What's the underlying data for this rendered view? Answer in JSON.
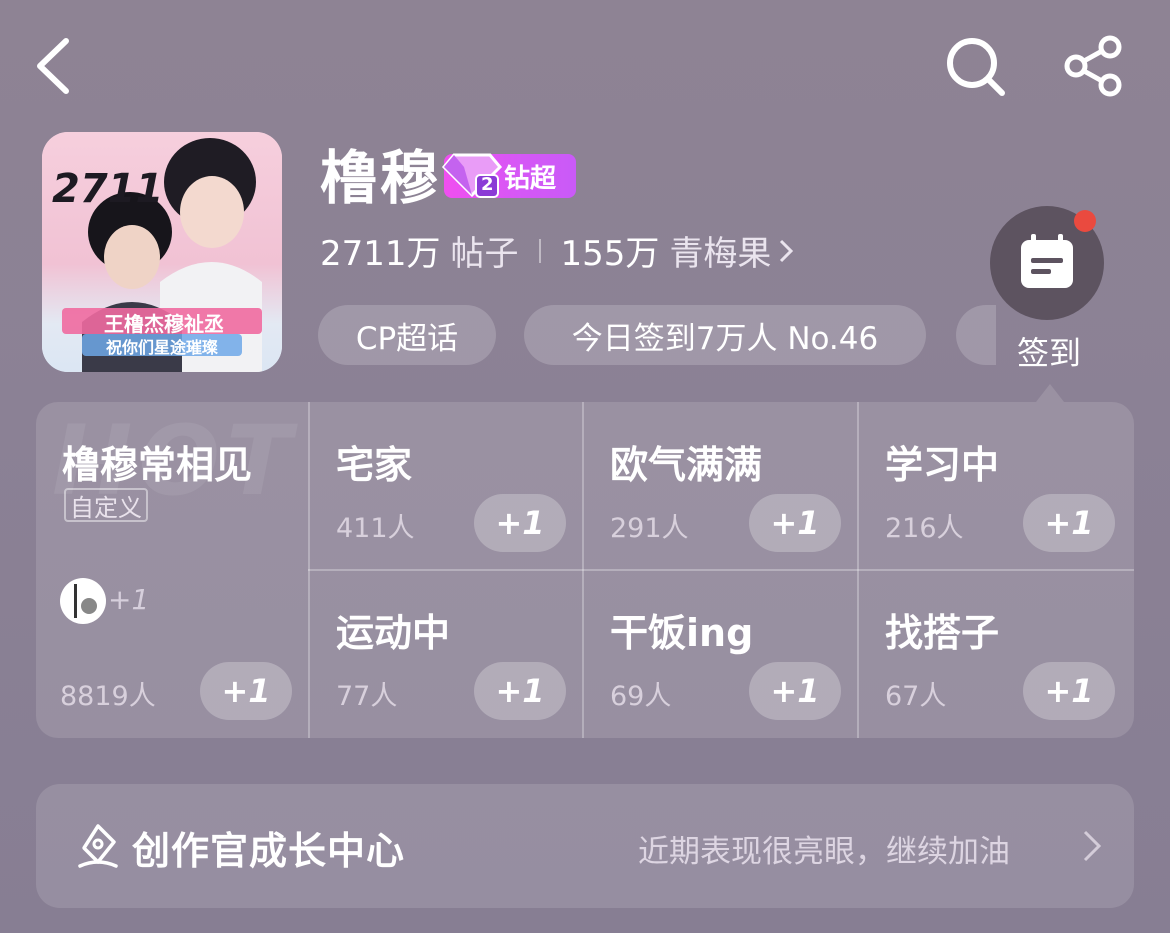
{
  "header": {
    "back_icon": "chevron-left-icon",
    "search_icon": "search-icon",
    "share_icon": "share-icon"
  },
  "topic": {
    "title": "橹穆",
    "badge_label": "钻超",
    "badge_level": "2",
    "cover_text_top": "2711",
    "cover_text_line1": "王橹杰穆祉丞",
    "cover_text_line2": "祝你们星途璀璨",
    "posts_count": "2711万",
    "posts_label": "帖子",
    "fans_count": "155万",
    "fans_label": "青梅果",
    "chips": [
      "CP超话",
      "今日签到7万人 No.46"
    ]
  },
  "checkin": {
    "label": "签到",
    "icon": "calendar-note-icon"
  },
  "watermark": "HOT",
  "featured": {
    "title": "橹穆常相见",
    "tag": "自定义",
    "mini_plus": "+1",
    "count": "8819人",
    "plus_label": "+1"
  },
  "statuses": [
    {
      "title": "宅家",
      "count": "411人",
      "plus_label": "+1"
    },
    {
      "title": "欧气满满",
      "count": "291人",
      "plus_label": "+1"
    },
    {
      "title": "学习中",
      "count": "216人",
      "plus_label": "+1"
    },
    {
      "title": "运动中",
      "count": "77人",
      "plus_label": "+1"
    },
    {
      "title": "干饭ing",
      "count": "69人",
      "plus_label": "+1"
    },
    {
      "title": "找搭子",
      "count": "67人",
      "plus_label": "+1"
    }
  ],
  "creator": {
    "title": "创作官成长中心",
    "subtitle": "近期表现很亮眼，继续加油",
    "icon": "creator-pen-icon"
  },
  "colors": {
    "badge": "#e04ff4",
    "red_dot": "#ea4a3f",
    "checkin_bg": "#5d5360"
  }
}
